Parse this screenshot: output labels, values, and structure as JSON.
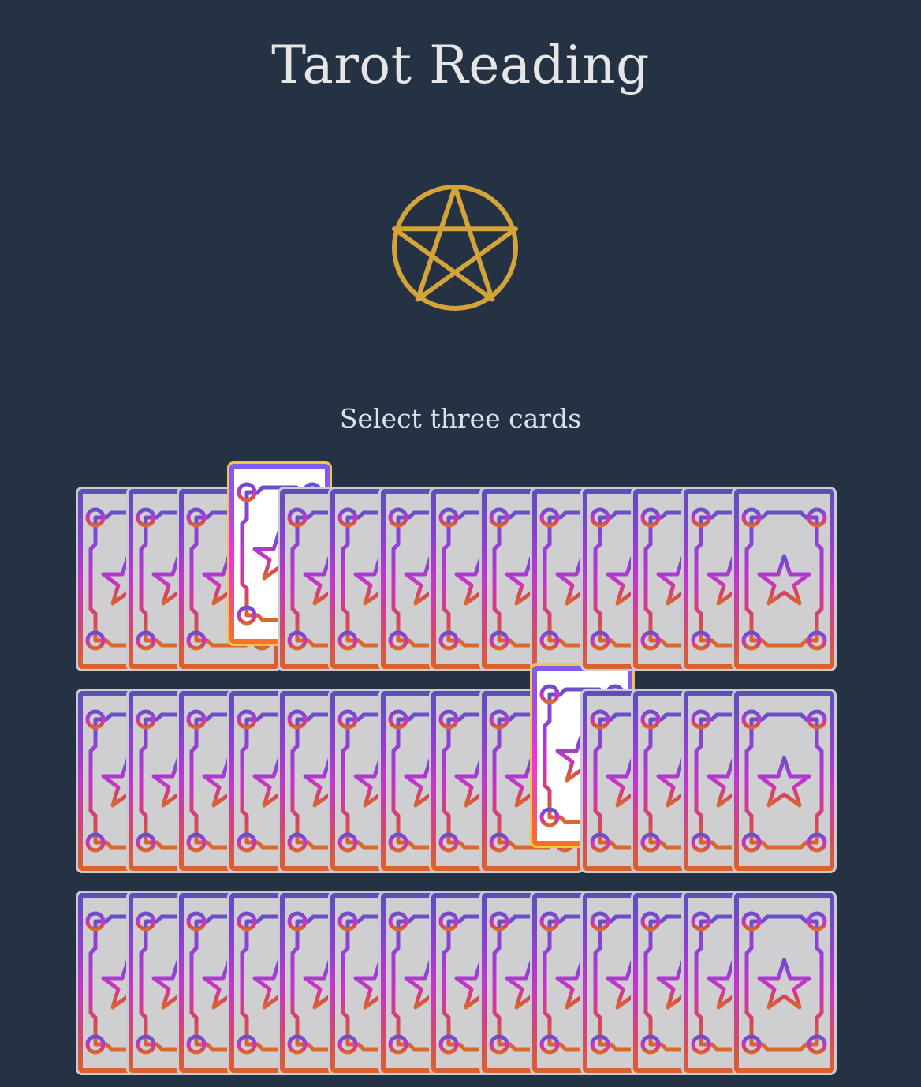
{
  "page": {
    "title": "Tarot Reading",
    "instruction": "Select three cards"
  },
  "emblem": {
    "icon": "pentagram-icon",
    "color": "#d4a33a"
  },
  "theme": {
    "background": "#243244",
    "title_color": "#e6e6e6",
    "card_border": "#c8cbd1",
    "card_face": "#cfcfd2",
    "selected_border": "#f3c64a",
    "card_gradient": [
      "#5b4fb9",
      "#8e3fd0",
      "#c536c9",
      "#d4476e",
      "#d9632b"
    ]
  },
  "deck": {
    "card_back_icon": "star-card-back-icon",
    "rows": [
      {
        "row": 1,
        "card_count": 14,
        "selected_card": 4
      },
      {
        "row": 2,
        "card_count": 14,
        "selected_card": 10
      },
      {
        "row": 3,
        "card_count": 14,
        "selected_card": null
      }
    ]
  }
}
